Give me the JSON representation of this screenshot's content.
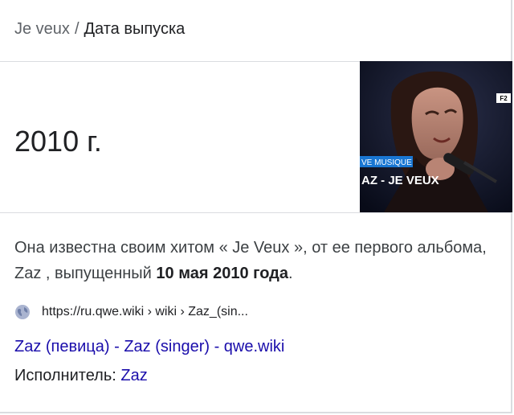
{
  "breadcrumb": {
    "parent": "Je veux",
    "separator": "/",
    "current": "Дата выпуска"
  },
  "answer": {
    "value": "2010 г."
  },
  "thumbnail": {
    "caption_top": "VE MUSIQUE",
    "caption_main": "AZ - JE VEUX",
    "corner_badge": "F2"
  },
  "snippet": {
    "text_before": "Она известна своим хитом « Je Veux », от ее первого альбома, Zaz , выпущенный ",
    "bold": "10 мая 2010 года",
    "text_after": "."
  },
  "source": {
    "icon": "globe-icon",
    "url": "https://ru.qwe.wiki › wiki › Zaz_(sin..."
  },
  "result": {
    "title": "Zaz (певица) - Zaz (singer) - qwe.wiki"
  },
  "performer": {
    "label": "Исполнитель:",
    "value": "Zaz"
  },
  "colors": {
    "link": "#1a0dab",
    "text": "#202124",
    "muted": "#5f6368",
    "divider": "#dadce0"
  }
}
